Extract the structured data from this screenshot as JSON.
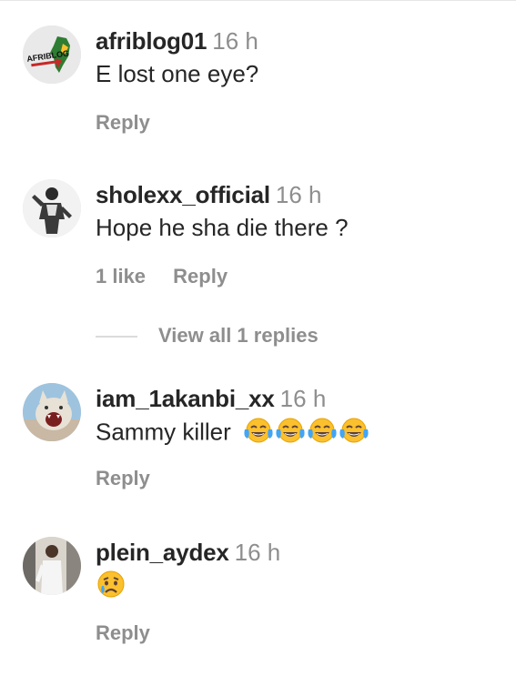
{
  "comments": [
    {
      "username": "afriblog01",
      "time": "16 h",
      "text": "E lost one eye?",
      "reply_label": "Reply",
      "avatar_logo_text": "AFRIBLOG"
    },
    {
      "username": "sholexx_official",
      "time": "16 h",
      "text": "Hope he sha die there ?",
      "likes_label": "1 like",
      "reply_label": "Reply",
      "view_replies_label": "View all 1 replies"
    },
    {
      "username": "iam_1akanbi_xx",
      "time": "16 h",
      "text": "Sammy killer",
      "emojis": [
        "face-with-tears-of-joy",
        "face-with-tears-of-joy",
        "face-with-tears-of-joy",
        "face-with-tears-of-joy"
      ],
      "reply_label": "Reply"
    },
    {
      "username": "plein_aydex",
      "time": "16 h",
      "emojis": [
        "crying-face"
      ],
      "reply_label": "Reply"
    }
  ],
  "colors": {
    "text": "#262626",
    "secondary": "#8e8e8e",
    "divider": "#dbdbdb",
    "emoji_yellow": "#fbc02d",
    "emoji_tear": "#42a5f5"
  }
}
